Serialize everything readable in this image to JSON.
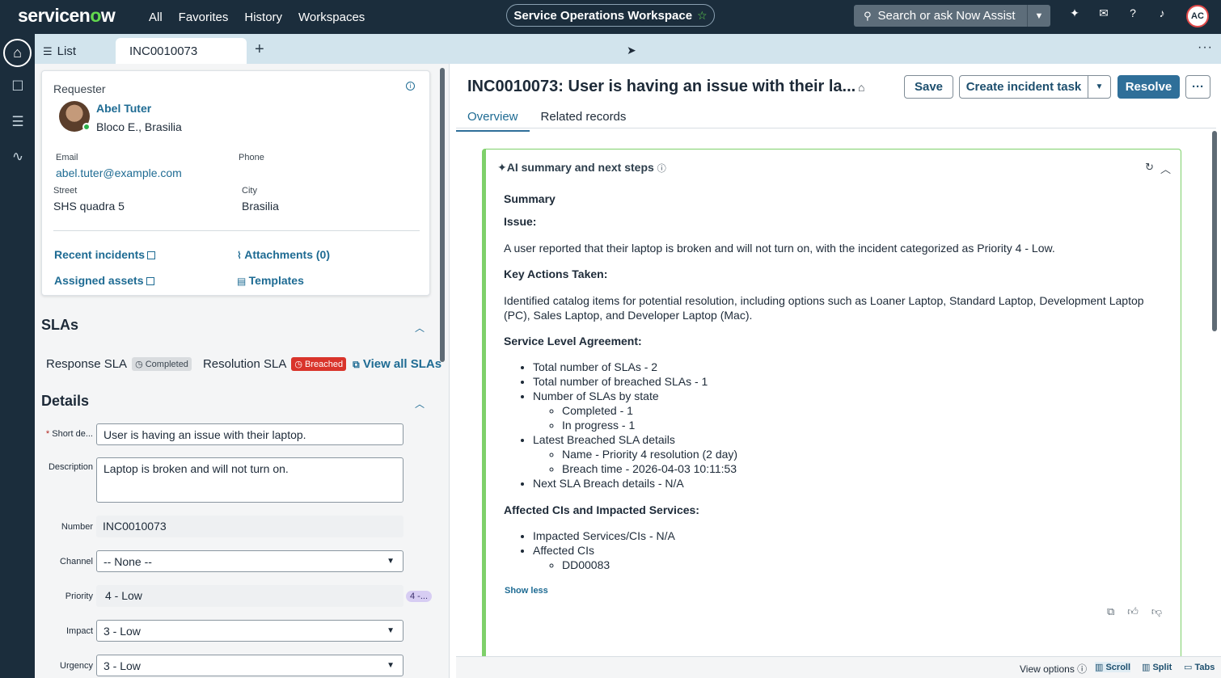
{
  "topnav": {
    "logo_prefix": "servicen",
    "logo_o": "o",
    "logo_suffix": "w",
    "links": [
      "All",
      "Favorites",
      "History",
      "Workspaces"
    ],
    "workspace": "Service Operations Workspace",
    "search_placeholder": "Search or ask Now Assist",
    "avatar_initials": "AC"
  },
  "tabs": {
    "list_label": "List",
    "active_tab": "INC0010073",
    "add": "+",
    "more": "···"
  },
  "requester": {
    "heading": "Requester",
    "name": "Abel Tuter",
    "location": "Bloco E., Brasilia",
    "email_label": "Email",
    "email": "abel.tuter@example.com",
    "phone_label": "Phone",
    "phone": "",
    "street_label": "Street",
    "street": "SHS quadra 5",
    "city_label": "City",
    "city": "Brasilia",
    "recent_incidents": "Recent incidents",
    "attachments": "Attachments (0)",
    "assigned_assets": "Assigned assets",
    "templates": "Templates"
  },
  "slas": {
    "heading": "SLAs",
    "response_label": "Response SLA",
    "response_badge": "Completed",
    "resolution_label": "Resolution SLA",
    "resolution_badge": "Breached",
    "view_all": "View all SLAs"
  },
  "details": {
    "heading": "Details",
    "short_desc_label": "Short de...",
    "short_desc": "User is having an issue with their laptop.",
    "description_label": "Description",
    "description": "Laptop is broken and will not turn on.",
    "number_label": "Number",
    "number": "INC0010073",
    "channel_label": "Channel",
    "channel": "-- None --",
    "priority_label": "Priority",
    "priority": "4 - Low",
    "priority_pill": "4 -...",
    "impact_label": "Impact",
    "impact": "3 - Low",
    "urgency_label": "Urgency",
    "urgency": "3 - Low"
  },
  "record": {
    "title": "INC0010073: User is having an issue with their la...",
    "save": "Save",
    "create_task": "Create incident task",
    "resolve": "Resolve",
    "more": "···",
    "tab_overview": "Overview",
    "tab_related": "Related records"
  },
  "ai": {
    "heading": "AI summary and next steps",
    "summary": "Summary",
    "issue_h": "Issue:",
    "issue": "A user reported that their laptop is broken and will not turn on, with the incident categorized as Priority 4 - Low.",
    "actions_h": "Key Actions Taken:",
    "actions_1": "Identified catalog items for potential resolution, including options such as Loaner Laptop, Standard Laptop, Development Laptop",
    "actions_2": "(PC), Sales Laptop, and Developer Laptop (Mac).",
    "sla_h": "Service Level Agreement:",
    "sla_items": {
      "total": "Total number of SLAs - 2",
      "breached": "Total number of breached SLAs - 1",
      "by_state": "Number of SLAs by state",
      "completed": "Completed - 1",
      "in_progress": "In progress - 1",
      "latest": "Latest Breached SLA details",
      "name": "Name - Priority 4 resolution (2 day)",
      "breach_time": "Breach time - 2026-04-03 10:11:53",
      "next": "Next SLA Breach details - N/A"
    },
    "cis_h": "Affected CIs and Impacted Services:",
    "cis_items": {
      "impacted": "Impacted Services/CIs - N/A",
      "affected": "Affected CIs",
      "ci": "DD00083"
    },
    "show_less": "Show less"
  },
  "bottombar": {
    "view_options": "View options",
    "scroll": "Scroll",
    "split": "Split",
    "tabs": "Tabs"
  }
}
